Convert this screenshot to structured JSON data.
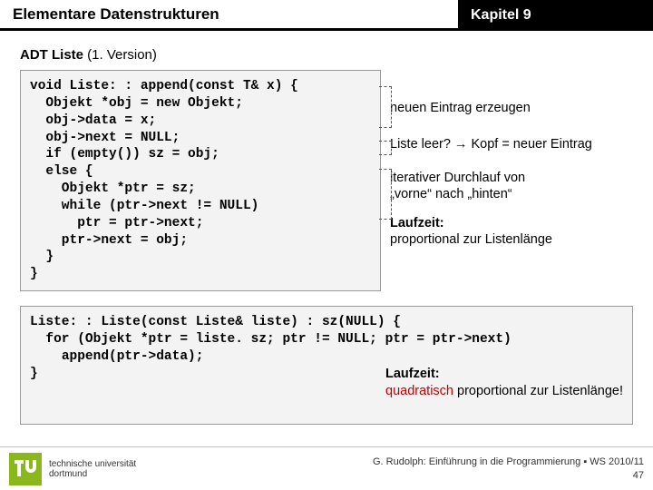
{
  "header": {
    "title_left": "Elementare Datenstrukturen",
    "title_right": "Kapitel 9"
  },
  "subtitle": {
    "bold": "ADT Liste",
    "rest": " (1. Version)"
  },
  "code1": "void Liste: : append(const T& x) {\n  Objekt *obj = new Objekt;\n  obj->data = x;\n  obj->next = NULL;\n  if (empty()) sz = obj;\n  else {\n    Objekt *ptr = sz;\n    while (ptr->next != NULL)\n      ptr = ptr->next;\n    ptr->next = obj;\n  }\n}",
  "annotations": {
    "a1": "neuen Eintrag erzeugen",
    "a2": "Liste leer? → Kopf = neuer Eintrag",
    "a3_l1": "iterativer Durchlauf von",
    "a3_l2": "„vorne“ nach „hinten“",
    "a4_b": "Laufzeit:",
    "a4_rest": "proportional zur Listenlänge"
  },
  "code2": "Liste: : Liste(const Liste& liste) : sz(NULL) {\n  for (Objekt *ptr = liste. sz; ptr != NULL; ptr = ptr->next)\n    append(ptr->data);\n}",
  "runtime2": {
    "label": "Laufzeit:",
    "quad": "quadratisch",
    "rest": " proportional zur Listenlänge!"
  },
  "footer": {
    "uni_l1": "technische universität",
    "uni_l2": "dortmund",
    "credit": "G. Rudolph: Einführung in die Programmierung ▪ WS 2010/11",
    "page": "47"
  }
}
